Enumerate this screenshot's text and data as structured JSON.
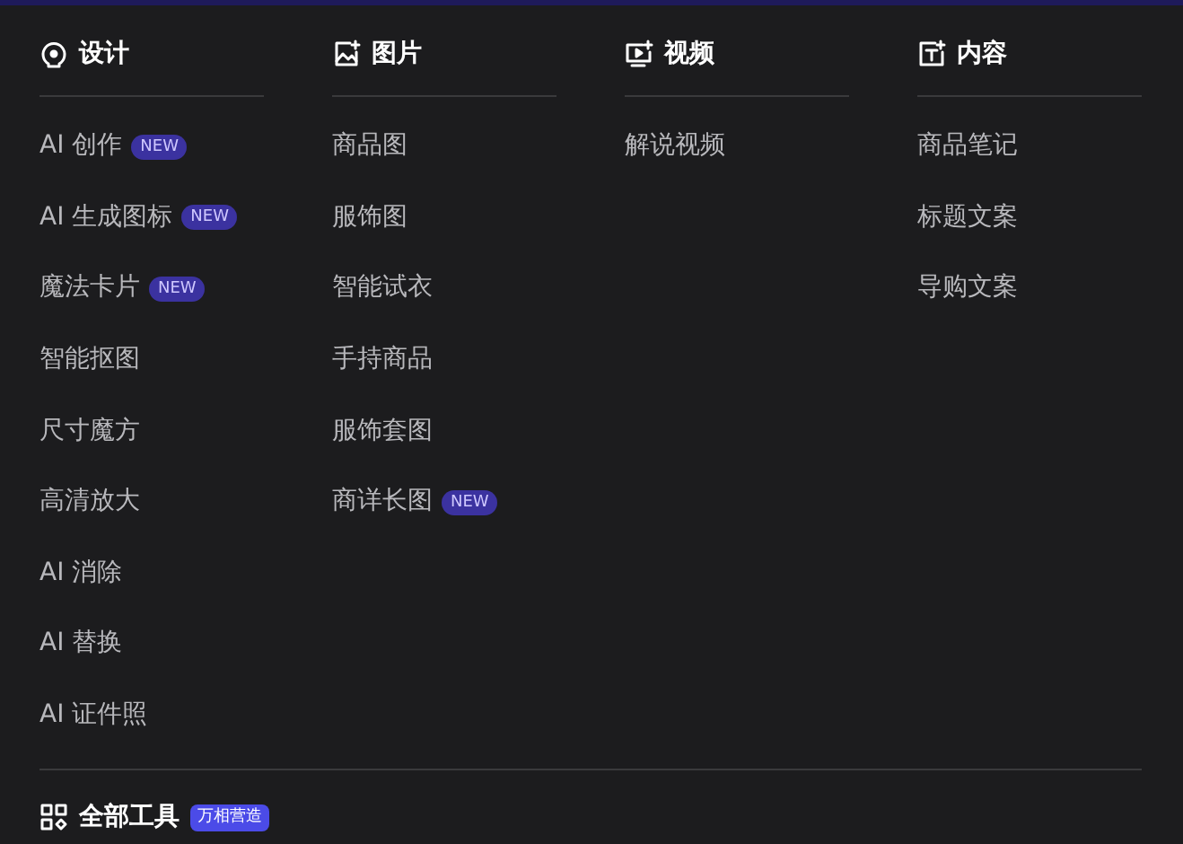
{
  "categories": [
    {
      "title": "设计",
      "kind": "design",
      "items": [
        {
          "label": "AI 创作",
          "badge": "NEW"
        },
        {
          "label": "AI 生成图标",
          "badge": "NEW"
        },
        {
          "label": "魔法卡片",
          "badge": "NEW"
        },
        {
          "label": "智能抠图"
        },
        {
          "label": "尺寸魔方"
        },
        {
          "label": "高清放大"
        },
        {
          "label": "AI 消除"
        },
        {
          "label": "AI 替换"
        },
        {
          "label": "AI 证件照"
        }
      ]
    },
    {
      "title": "图片",
      "kind": "image",
      "items": [
        {
          "label": "商品图"
        },
        {
          "label": "服饰图"
        },
        {
          "label": "智能试衣"
        },
        {
          "label": "手持商品"
        },
        {
          "label": "服饰套图"
        },
        {
          "label": "商详长图",
          "badge": "NEW"
        }
      ]
    },
    {
      "title": "视频",
      "kind": "video",
      "items": [
        {
          "label": "解说视频"
        }
      ]
    },
    {
      "title": "内容",
      "kind": "text",
      "items": [
        {
          "label": "商品笔记"
        },
        {
          "label": "标题文案"
        },
        {
          "label": "导购文案"
        }
      ]
    }
  ],
  "footer": {
    "label": "全部工具",
    "badge": "万相营造"
  }
}
